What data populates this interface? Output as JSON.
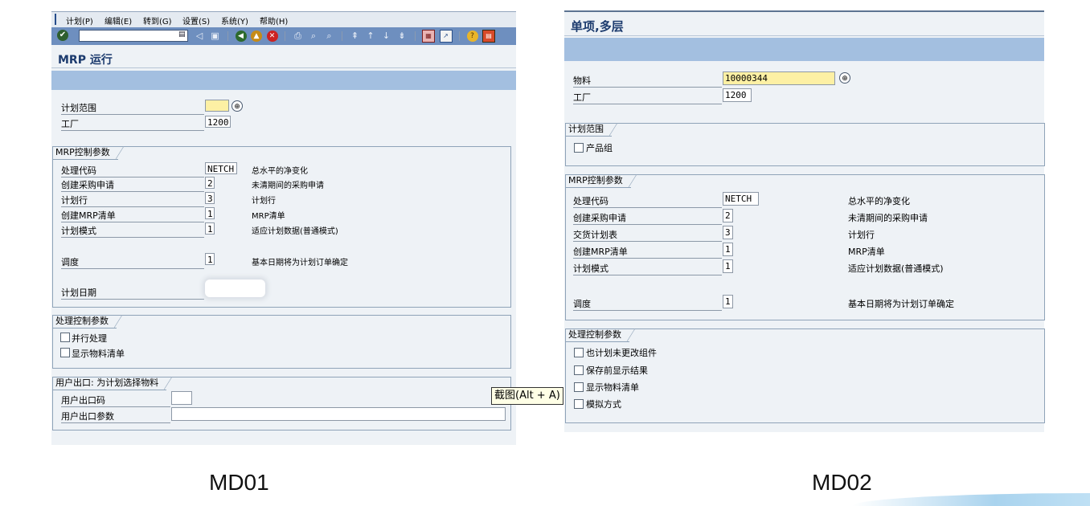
{
  "left": {
    "menu": [
      "计划(P)",
      "编辑(E)",
      "转到(G)",
      "设置(S)",
      "系统(Y)",
      "帮助(H)"
    ],
    "title": "MRP 运行",
    "fields": {
      "plan_scope_label": "计划范围",
      "plant_label": "工厂",
      "plant_value": "1200"
    },
    "mrp_group": {
      "title": "MRP控制参数",
      "rows": [
        {
          "label": "处理代码",
          "value": "NETCH",
          "desc": "总水平的净变化"
        },
        {
          "label": "创建采购申请",
          "value": "2",
          "desc": "未清期间的采购申请"
        },
        {
          "label": "计划行",
          "value": "3",
          "desc": "计划行"
        },
        {
          "label": "创建MRP清单",
          "value": "1",
          "desc": "MRP清单"
        },
        {
          "label": "计划模式",
          "value": "1",
          "desc": "适应计划数据(普通模式)"
        }
      ],
      "schedule": {
        "label": "调度",
        "value": "1",
        "desc": "基本日期将为计划订单确定"
      },
      "plan_date_label": "计划日期"
    },
    "proc_group": {
      "title": "处理控制参数",
      "options": [
        "并行处理",
        "显示物料清单"
      ]
    },
    "exit_group": {
      "title": "用户出口: 为计划选择物料",
      "code_label": "用户出口码",
      "param_label": "用户出口参数"
    },
    "caption": "MD01"
  },
  "right": {
    "title": "单项,多层",
    "fields": {
      "material_label": "物料",
      "material_value": "10000344",
      "plant_label": "工厂",
      "plant_value": "1200"
    },
    "scope_group": {
      "title": "计划范围",
      "option": "产品组"
    },
    "mrp_group": {
      "title": "MRP控制参数",
      "rows": [
        {
          "label": "处理代码",
          "value": "NETCH",
          "desc": "总水平的净变化"
        },
        {
          "label": "创建采购申请",
          "value": "2",
          "desc": "未清期间的采购申请"
        },
        {
          "label": "交货计划表",
          "value": "3",
          "desc": "计划行"
        },
        {
          "label": "创建MRP清单",
          "value": "1",
          "desc": "MRP清单"
        },
        {
          "label": "计划模式",
          "value": "1",
          "desc": "适应计划数据(普通模式)"
        }
      ],
      "schedule": {
        "label": "调度",
        "value": "1",
        "desc": "基本日期将为计划订单确定"
      }
    },
    "proc_group": {
      "title": "处理控制参数",
      "options": [
        "也计划未更改组件",
        "保存前显示结果",
        "显示物料清单",
        "模拟方式"
      ]
    },
    "caption": "MD02"
  },
  "tooltip": "截图(Alt + A)"
}
